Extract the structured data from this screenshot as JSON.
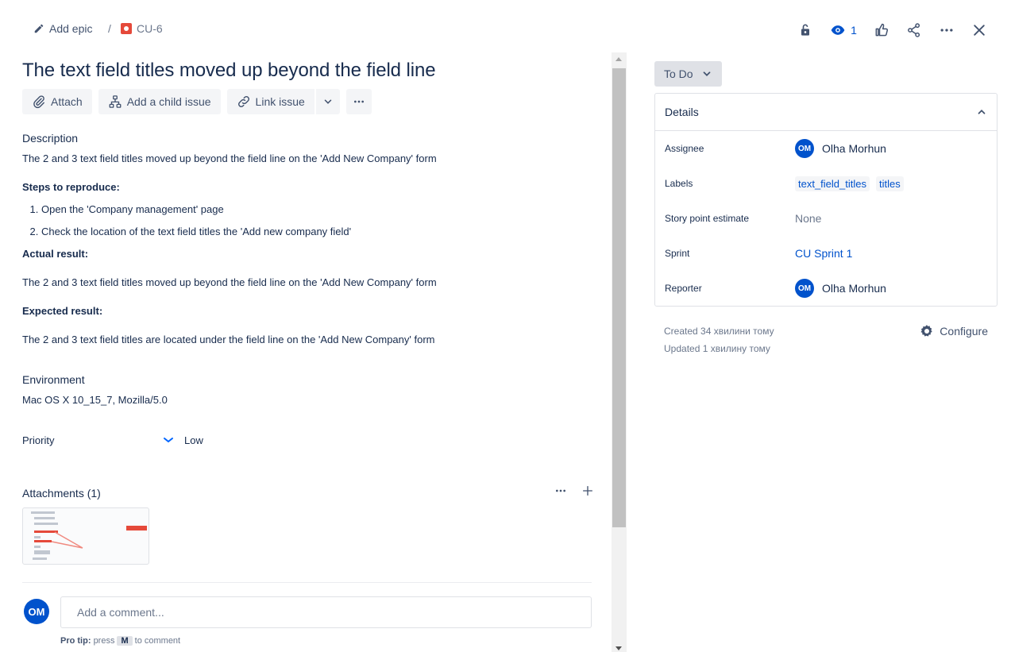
{
  "breadcrumb": {
    "add_epic": "Add epic",
    "separator": "/",
    "issue_key": "CU-6"
  },
  "header_actions": {
    "watch_count": "1",
    "icons": [
      "unlock-icon",
      "eye-icon",
      "like-icon",
      "share-icon",
      "more-icon",
      "close-icon"
    ]
  },
  "issue": {
    "title": "The text field titles moved up beyond the field line"
  },
  "toolbar": {
    "attach": "Attach",
    "add_child": "Add a child issue",
    "link_issue": "Link issue"
  },
  "description": {
    "heading": "Description",
    "summary": "The 2 and 3 text field titles moved up beyond the field line on the 'Add New Company' form",
    "steps_heading": "Steps to reproduce:",
    "steps": [
      "Open the 'Company management' page",
      "Check the location of the text field titles the 'Add new company field'"
    ],
    "actual_heading": "Actual result:",
    "actual": "The 2 and 3 text field titles moved up beyond the field line on the 'Add New Company' form",
    "expected_heading": "Expected result:",
    "expected": "The 2 and 3 text field titles are located under the field line on the 'Add New Company' form"
  },
  "environment": {
    "heading": "Environment",
    "value": "Mac OS X 10_15_7, Mozilla/5.0"
  },
  "priority": {
    "label": "Priority",
    "value": "Low"
  },
  "attachments": {
    "heading": "Attachments (1)"
  },
  "comment": {
    "avatar": "OM",
    "placeholder": "Add a comment...",
    "protip_label": "Pro tip:",
    "protip_press": "press",
    "protip_key": "M",
    "protip_suffix": "to comment"
  },
  "status": {
    "label": "To Do"
  },
  "details": {
    "heading": "Details",
    "assignee_label": "Assignee",
    "assignee_initials": "OM",
    "assignee": "Olha Morhun",
    "labels_label": "Labels",
    "labels": [
      "text_field_titles",
      "titles"
    ],
    "story_points_label": "Story point estimate",
    "story_points": "None",
    "sprint_label": "Sprint",
    "sprint": "CU Sprint 1",
    "reporter_label": "Reporter",
    "reporter_initials": "OM",
    "reporter": "Olha Morhun"
  },
  "meta": {
    "created": "Created 34 хвилини тому",
    "updated": "Updated 1 хвилину тому",
    "configure": "Configure"
  },
  "colors": {
    "accent": "#0052cc",
    "bug": "#e5493a",
    "text": "#172b4d"
  }
}
